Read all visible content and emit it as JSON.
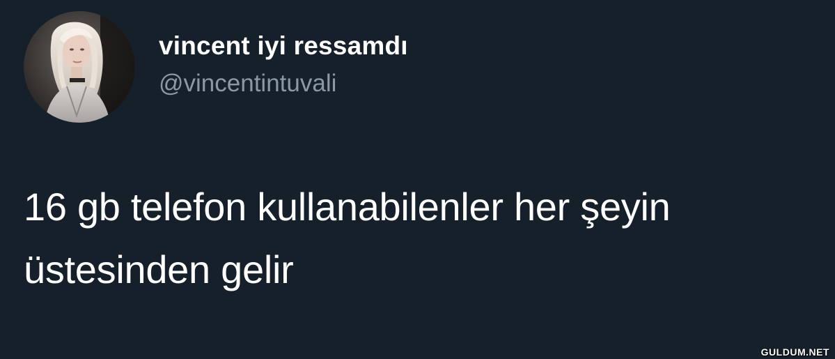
{
  "user": {
    "display_name": "vincent iyi ressamdı",
    "handle": "@vincentintuvali"
  },
  "tweet": {
    "line1": "16 gb telefon kullanabilenler her şeyin",
    "line2": "üstesinden gelir"
  },
  "watermark": "GULDUM.NET",
  "colors": {
    "background": "#15202b",
    "text": "#ffffff",
    "handle": "#8b98a5"
  }
}
